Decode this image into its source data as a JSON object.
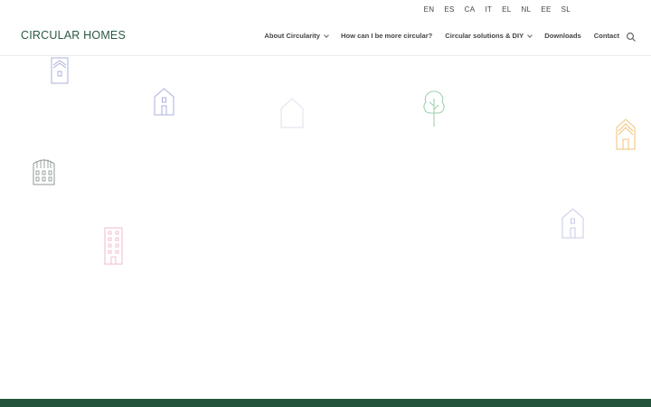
{
  "languages": [
    "EN",
    "ES",
    "CA",
    "IT",
    "EL",
    "NL",
    "EE",
    "SL"
  ],
  "logo": "CIRCULAR HOMES",
  "nav": {
    "items": [
      {
        "label": "About Circularity",
        "dropdown": true
      },
      {
        "label": "How can I be more circular?",
        "dropdown": false
      },
      {
        "label": "Circular solutions & DIY",
        "dropdown": true
      },
      {
        "label": "Downloads",
        "dropdown": false
      },
      {
        "label": "Contact",
        "dropdown": false
      }
    ],
    "search_icon": "search-icon"
  },
  "colors": {
    "brand": "#2a5a40",
    "footer": "#23543a",
    "icon_blue": "#aab0dc",
    "icon_blue_light": "#c7cbe8",
    "icon_green": "#9fd0ad",
    "icon_orange": "#f1c27a",
    "icon_gray": "#8f9a96",
    "icon_pink": "#f2b8d0"
  },
  "decorative_icons": [
    "tall-house-icon",
    "small-house-icon",
    "outline-house-icon",
    "tree-icon",
    "stepped-house-icon",
    "apartment-building-icon",
    "small-house-right-icon",
    "tower-building-icon"
  ]
}
